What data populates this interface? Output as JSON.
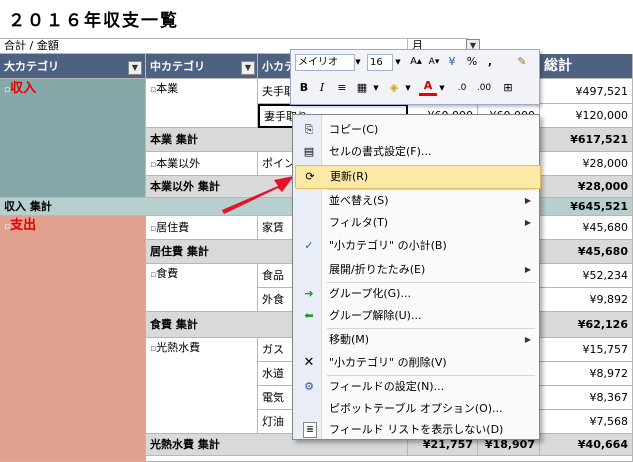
{
  "title": "２０１６年収支一覧",
  "labels": {
    "sum_amount": "合計 / 金額",
    "month": "月"
  },
  "headers": {
    "major": "大カテゴリ",
    "middle": "中カテゴリ",
    "minor": "小カテ",
    "total": "総計"
  },
  "rows": {
    "income": "収入",
    "hongyo": "本業",
    "husband": "夫手取り",
    "wife": "妻手取り",
    "wife_v1": "¥60,000",
    "wife_v2": "¥60,000",
    "hongyo_total": "本業 集計",
    "other_income": "本業以外",
    "point": "ポイン",
    "other_total": "本業以外 集計",
    "income_total": "収入 集計",
    "expense": "支出",
    "housing": "居住費",
    "rent": "家賃",
    "housing_total": "居住費 集計",
    "food": "食費",
    "groceries": "食品",
    "eating_out": "外食",
    "food_total": "食費 集計",
    "utilities": "光熱水費",
    "gas": "ガス",
    "water": "水道",
    "electricity": "電気",
    "kerosene": "灯油",
    "utilities_total": "光熱水費 集計",
    "util_total_v1": "¥21,757",
    "util_total_v2": "¥18,907"
  },
  "partial_cols": {
    "r1": "94",
    "r3": "94",
    "r7": "94",
    "r8": "40",
    "r9": "40",
    "r10": "59",
    "r12": "96",
    "r13": "45",
    "r14": "40",
    "r15": "18",
    "r16": "46"
  },
  "totals": {
    "husband": "¥497,521",
    "wife": "¥120,000",
    "hongyo_total": "¥617,521",
    "point": "¥28,000",
    "other_total": "¥28,000",
    "income_total": "¥645,521",
    "rent": "¥45,680",
    "housing_total": "¥45,680",
    "groceries": "¥52,234",
    "eating_out": "¥9,892",
    "food_total": "¥62,126",
    "gas": "¥15,757",
    "water": "¥8,972",
    "electricity": "¥8,367",
    "kerosene": "¥7,568",
    "utilities_total": "¥40,664"
  },
  "toolbar": {
    "font": "メイリオ",
    "size": "16",
    "bold": "B",
    "italic": "I",
    "percent": "%",
    "comma": ",",
    "font_color_letter": "A"
  },
  "menu": {
    "copy": "コピー(C)",
    "format": "セルの書式設定(F)...",
    "refresh": "更新(R)",
    "sort": "並べ替え(S)",
    "filter": "フィルタ(T)",
    "subtotal": "\"小カテゴリ\" の小計(B)",
    "expand": "展開/折りたたみ(E)",
    "group": "グループ化(G)...",
    "ungroup": "グループ解除(U)...",
    "move": "移動(M)",
    "delete": "\"小カテゴリ\" の削除(V)",
    "field_settings": "フィールドの設定(N)...",
    "pivot_options": "ピボットテーブル オプション(O)...",
    "hide_field_list": "フィールド リストを表示しない(D)"
  },
  "colors": {
    "income_bg": "#87a8a8",
    "expense_bg": "#e2a08f",
    "header_bg": "#4f6181",
    "subtotal_bg": "#d9d9d9",
    "grand_total_bg": "#b8cfcf",
    "red_text": "#e00000",
    "menu_highlight": "#fde9a6",
    "arrow": "#e8102a"
  }
}
